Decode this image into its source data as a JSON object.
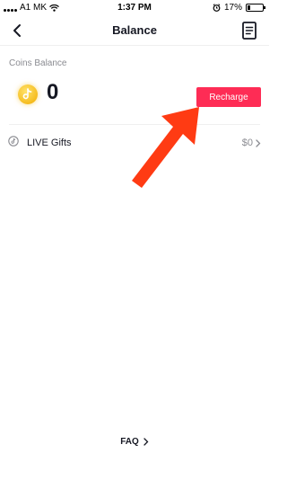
{
  "status_bar": {
    "carrier": "A1 MK",
    "time": "1:37 PM",
    "battery": "17%",
    "battery_level": 0.17
  },
  "header": {
    "title": "Balance"
  },
  "coins": {
    "section_label": "Coins Balance",
    "amount": "0",
    "recharge_label": "Recharge"
  },
  "live_gifts": {
    "label": "LIVE Gifts",
    "value": "$0"
  },
  "footer": {
    "faq_label": "FAQ"
  },
  "colors": {
    "accent": "#fe2c55",
    "annotation_arrow": "#ff3b13",
    "coin": "#f7c22a"
  }
}
